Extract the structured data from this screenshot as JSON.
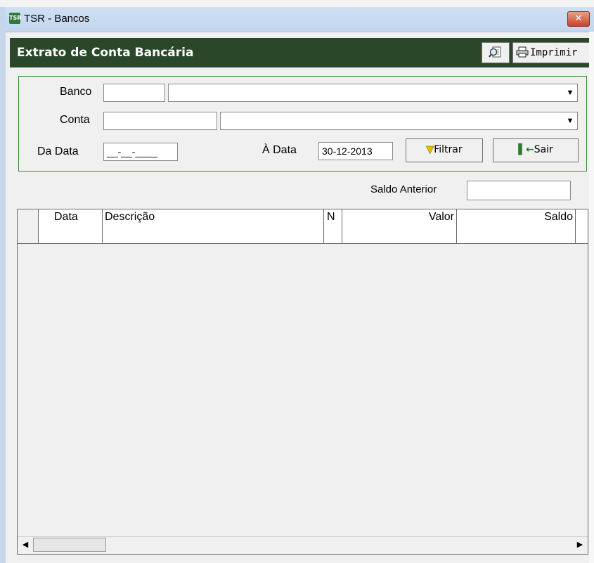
{
  "window": {
    "title": "TSR - Bancos",
    "icon_text": "TSR",
    "close_glyph": "✕"
  },
  "header": {
    "title": "Extrato de Conta Bancária",
    "preview_icon": "magnifier-document-icon",
    "print_label": "Imprimir",
    "print_icon": "printer-icon"
  },
  "filters": {
    "banco_label": "Banco",
    "banco_code": "",
    "banco_name": "",
    "conta_label": "Conta",
    "conta_code": "",
    "conta_name": "",
    "da_data_label": "Da Data",
    "da_data_value": "__-__-____",
    "a_data_label": "À Data",
    "a_data_value": "30-12-2013",
    "filtrar_label": "Filtrar",
    "filtrar_icon": "funnel-icon",
    "sair_label": "Sair",
    "sair_icon": "exit-door-icon",
    "saldo_anterior_label": "Saldo Anterior",
    "saldo_anterior_value": ""
  },
  "grid": {
    "columns": [
      "Data",
      "Descrição",
      "N",
      "Valor",
      "Saldo"
    ],
    "rows": [
      [
        "",
        "",
        "",
        "",
        ""
      ]
    ]
  },
  "colors": {
    "header_bg": "#2a472a",
    "filter_border": "#3b8a3b",
    "titlebar": "#c2d6ee",
    "close_button": "#c7432a"
  }
}
